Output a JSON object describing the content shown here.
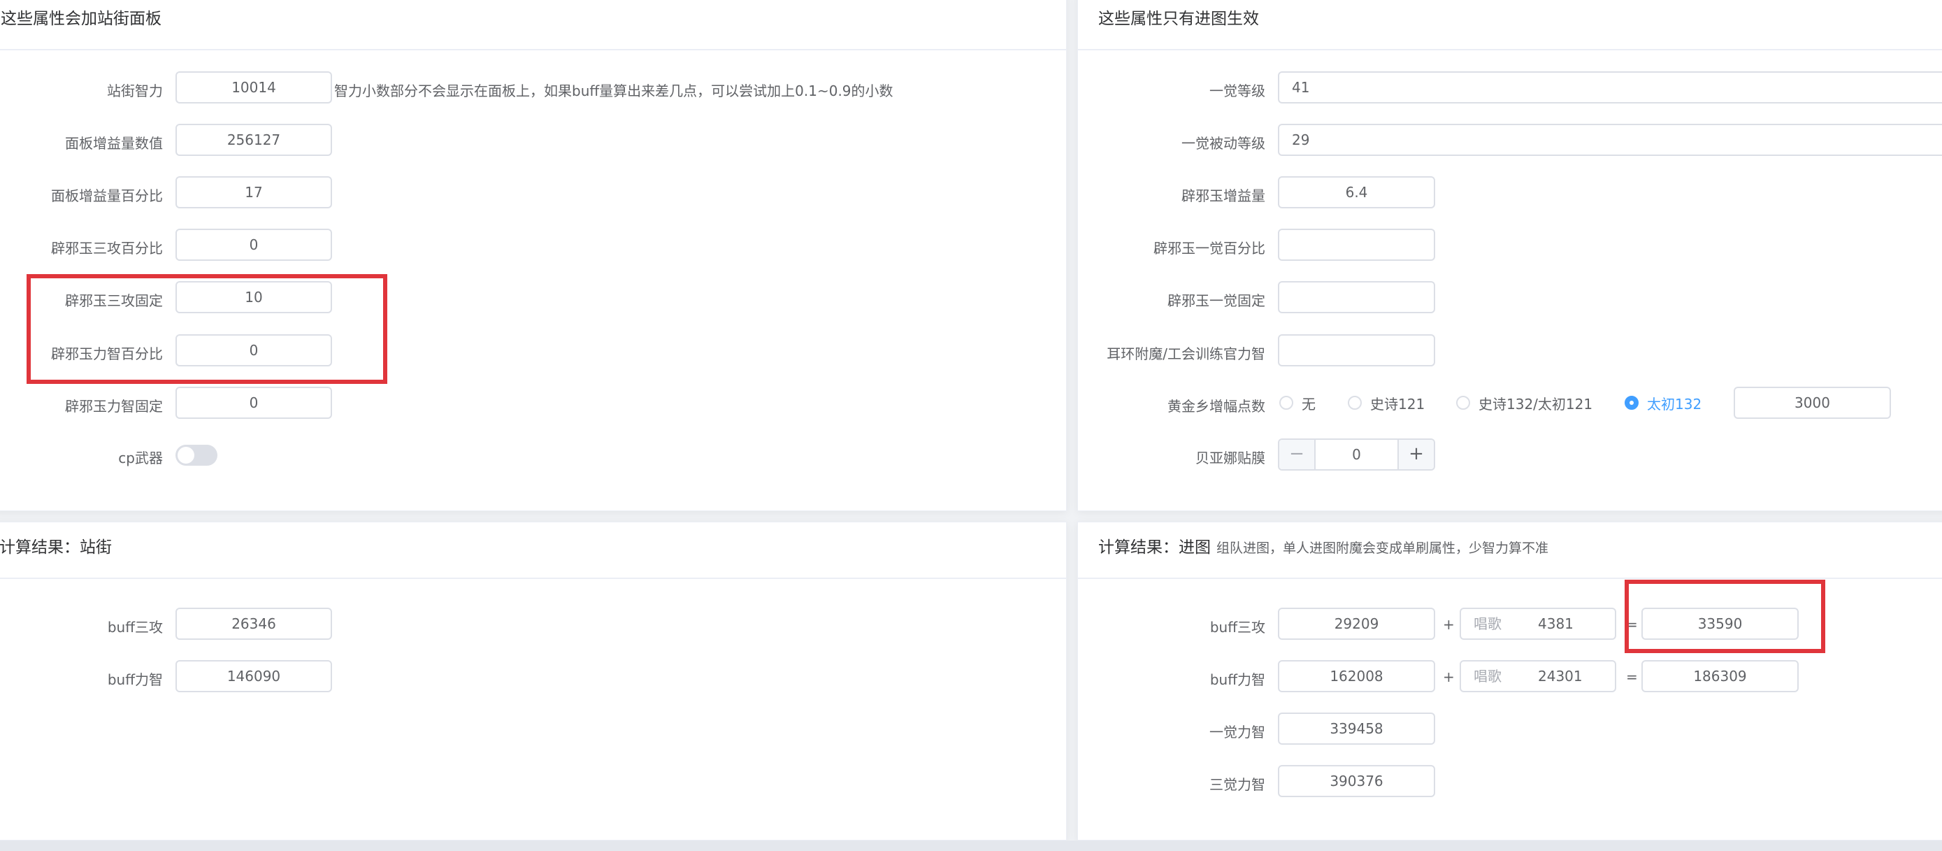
{
  "left_panel": {
    "title": "这些属性会加站街面板",
    "fields": [
      {
        "label": "站街智力",
        "value": "10014"
      },
      {
        "label": "面板增益量数值",
        "value": "256127"
      },
      {
        "label": "面板增益量百分比",
        "value": "17"
      },
      {
        "label": "辟邪玉三攻百分比",
        "value": "0"
      },
      {
        "label": "辟邪玉三攻固定",
        "value": "10"
      },
      {
        "label": "辟邪玉力智百分比",
        "value": "0"
      },
      {
        "label": "辟邪玉力智固定",
        "value": "0"
      }
    ],
    "int_hint": "智力小数部分不会显示在面板上，如果buff量算出来差几点，可以尝试加上0.1~0.9的小数",
    "cp_label": "cp武器",
    "cp_enabled": false
  },
  "right_panel": {
    "title": "这些属性只有进图生效",
    "fields": [
      {
        "label": "一觉等级",
        "value": "41"
      },
      {
        "label": "一觉被动等级",
        "value": "29"
      },
      {
        "label": "辟邪玉增益量",
        "value": "6.4"
      },
      {
        "label": "辟邪玉一觉百分比",
        "value": ""
      },
      {
        "label": "辟邪玉一觉固定",
        "value": ""
      },
      {
        "label": "耳环附魔/工会训练官力智",
        "value": ""
      }
    ],
    "gold_label": "黄金乡增幅点数",
    "gold_options": [
      "无",
      "史诗121",
      "史诗132/太初121",
      "太初132"
    ],
    "gold_selected": "太初132",
    "gold_value": "3000",
    "bayonetta_label": "贝亚娜贴膜",
    "bayonetta_value": "0"
  },
  "result_street": {
    "title": "计算结果：站街",
    "rows": [
      {
        "label": "buff三攻",
        "value": "26346"
      },
      {
        "label": "buff力智",
        "value": "146090"
      }
    ]
  },
  "result_dungeon": {
    "title": "计算结果：进图",
    "note": "组队进图，单人进图附魔会变成单刷属性，少智力算不准",
    "rows": [
      {
        "label": "buff三攻",
        "value": "29209",
        "song_prefix": "唱歌",
        "song_value": "4381",
        "total": "33590"
      },
      {
        "label": "buff力智",
        "value": "162008",
        "song_prefix": "唱歌",
        "song_value": "24301",
        "total": "186309"
      },
      {
        "label": "一觉力智",
        "value": "339458"
      },
      {
        "label": "三觉力智",
        "value": "390376"
      }
    ],
    "plus_sign": "+",
    "equals_sign": "="
  },
  "colors": {
    "accent": "#409eff",
    "highlight_red": "#e0353b",
    "border": "#dcdfe6"
  }
}
